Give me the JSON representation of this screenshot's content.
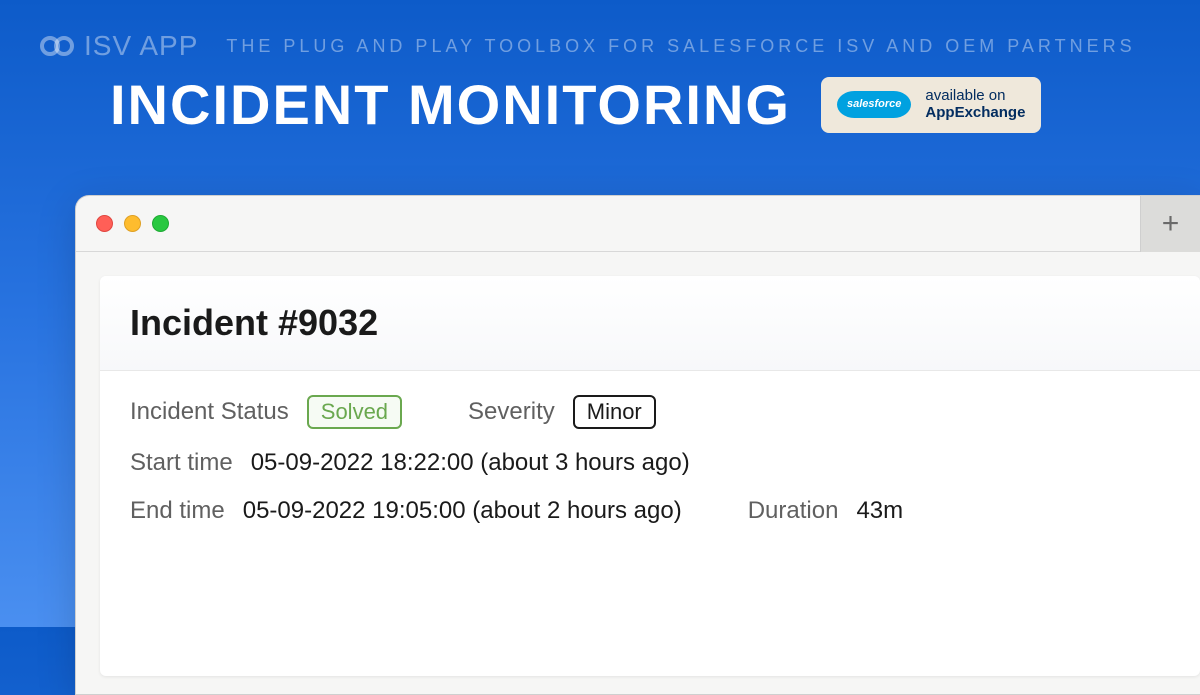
{
  "header": {
    "logo_text": "ISV aPP",
    "tagline": "THE PLUG AND PLAY TOOLBOX FOR SALESFORCE ISV AND OEM PARTNERS",
    "title": "INCIDENT MONITORING",
    "appexchange_badge": {
      "cloud_label": "salesforce",
      "line1": "available on",
      "line2": "AppExchange"
    }
  },
  "window": {
    "plus_label": "+"
  },
  "incident": {
    "title": "Incident #9032",
    "status_label": "Incident Status",
    "status_value": "Solved",
    "severity_label": "Severity",
    "severity_value": "Minor",
    "start_label": "Start time",
    "start_value": "05-09-2022 18:22:00 (about 3 hours ago)",
    "end_label": "End time",
    "end_value": "05-09-2022 19:05:00 (about 2 hours ago)",
    "duration_label": "Duration",
    "duration_value": "43m"
  }
}
